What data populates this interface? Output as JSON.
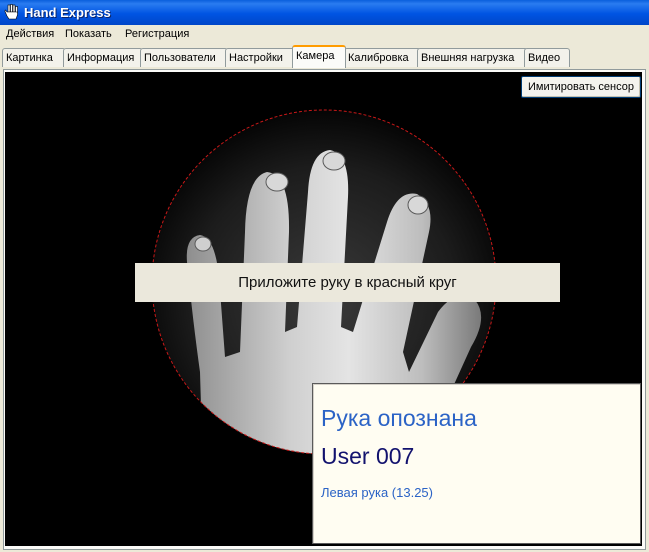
{
  "window": {
    "title": "Hand Express",
    "icon": "hand-icon"
  },
  "menu": [
    "Действия",
    "Показать",
    "Регистрация"
  ],
  "tabs": [
    {
      "label": "Картинка",
      "active": false
    },
    {
      "label": "Информация",
      "active": false
    },
    {
      "label": "Пользователи",
      "active": false
    },
    {
      "label": "Настройки",
      "active": false
    },
    {
      "label": "Камера",
      "active": true
    },
    {
      "label": "Калибровка",
      "active": false
    },
    {
      "label": "Внешняя нагрузка",
      "active": false
    },
    {
      "label": "Видео",
      "active": false
    }
  ],
  "camera": {
    "simulate_button": "Имитировать сенсор",
    "instruction": "Приложите руку в красный круг",
    "circle_color": "#c81818"
  },
  "result": {
    "status": "Рука опознана",
    "user": "User 007",
    "hand": "Левая рука (13.25)"
  },
  "colors": {
    "titlebar": "#0054e3",
    "active_tab_accent": "#ff9c00",
    "status_text": "#2b63c6",
    "user_text": "#12126e"
  }
}
